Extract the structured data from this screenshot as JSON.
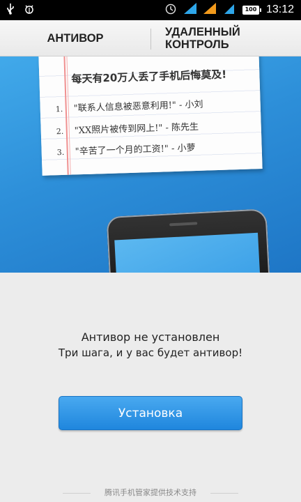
{
  "status_bar": {
    "time": "13:12",
    "battery": "100",
    "icons": [
      "usb-icon",
      "android-debug-icon",
      "alarm-icon",
      "signal-icon",
      "signal-icon",
      "wifi-icon",
      "battery-icon"
    ]
  },
  "tabs": [
    {
      "label": "АНТИВОР",
      "active": true
    },
    {
      "label_line1": "УДАЛЕННЫЙ",
      "label_line2": "КОНТРОЛЬ",
      "active": false
    }
  ],
  "banner": {
    "title": "每天有20万人丢了手机后悔莫及!",
    "quotes": [
      {
        "num": "1.",
        "text": "\"联系人信息被恶意利用!\" - 小刘"
      },
      {
        "num": "2.",
        "text": "\"XX照片被传到网上!\" - 陈先生"
      },
      {
        "num": "3.",
        "text": "\"辛苦了一个月的工资!\" - 小萝"
      }
    ]
  },
  "main": {
    "status_title": "Антивор не установлен",
    "status_subtitle": "Три шага, и у вас будет антивор!",
    "install_label": "Установка"
  },
  "footer": {
    "text": "腾讯手机管家提供技术支持"
  },
  "colors": {
    "accent": "#2a8bdc",
    "banner": "#2d8fd9",
    "button": "#2f94e6"
  }
}
